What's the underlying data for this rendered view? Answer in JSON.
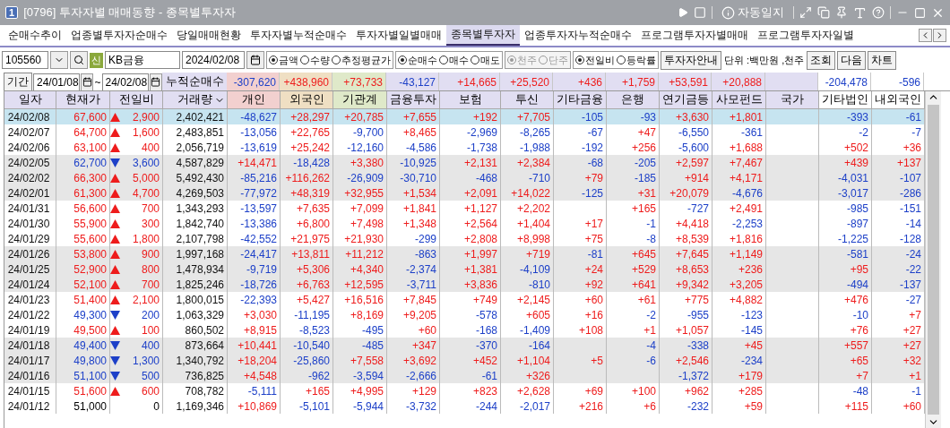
{
  "window": {
    "badge": "1",
    "title": "[0796] 투자자별 매매동향 - 종목별투자자",
    "auto_journal": "자동일지"
  },
  "tabs": [
    {
      "label": "순매수추이",
      "selected": false
    },
    {
      "label": "업종별투자자순매수",
      "selected": false
    },
    {
      "label": "당일매매현황",
      "selected": false
    },
    {
      "label": "투자자별누적순매수",
      "selected": false
    },
    {
      "label": "투자자별일별매매",
      "selected": false
    },
    {
      "label": "종목별투자자",
      "selected": true
    },
    {
      "label": "업종투자자누적순매수",
      "selected": false
    },
    {
      "label": "프로그램투자자별매매",
      "selected": false
    },
    {
      "label": "프로그램투자자일별",
      "selected": false
    }
  ],
  "controls": {
    "code": "105560",
    "credit_badge": "신",
    "name": "KB금융",
    "date": "2024/02/08",
    "radio_groups": [
      {
        "disabled": false,
        "options": [
          {
            "label": "금액",
            "selected": true
          },
          {
            "label": "수량",
            "selected": false
          },
          {
            "label": "추정평균가",
            "selected": false
          }
        ]
      },
      {
        "disabled": false,
        "options": [
          {
            "label": "순매수",
            "selected": true
          },
          {
            "label": "매수",
            "selected": false
          },
          {
            "label": "매도",
            "selected": false
          }
        ]
      },
      {
        "disabled": true,
        "options": [
          {
            "label": "천주",
            "selected": true
          },
          {
            "label": "단주",
            "selected": false
          }
        ]
      },
      {
        "disabled": false,
        "options": [
          {
            "label": "전일비",
            "selected": true
          },
          {
            "label": "등락률",
            "selected": false
          }
        ]
      }
    ],
    "guide_button": "투자자안내",
    "unit": "단위 :백만원 ,천주",
    "buttons": [
      "조회",
      "다음",
      "차트"
    ]
  },
  "period": {
    "button": "기간",
    "from": "24/01/08",
    "separator": "~",
    "to": "24/02/08",
    "label": "누적순매수",
    "totals": {
      "individual": "-307,620",
      "foreign": "+438,960",
      "institution": "+73,733",
      "fin_invest": "-43,127",
      "insurance": "+14,665",
      "trust": "+25,520",
      "other_fin": "+436",
      "bank": "+1,759",
      "pension": "+53,591",
      "private_fund": "+20,888",
      "other_corp": "-204,478",
      "domestic_foreign": "-596"
    }
  },
  "table": {
    "columns": [
      "일자",
      "현재가",
      "전일비",
      "거래량",
      "개인",
      "외국인",
      "기관계",
      "금융투자",
      "보험",
      "투신",
      "기타금융",
      "은행",
      "연기금등",
      "사모펀드",
      "국가",
      "기타법인",
      "내외국인"
    ],
    "rows": [
      {
        "date": "24/02/08",
        "price": "67,600",
        "kind": "up",
        "change": "2,900",
        "volume": "2,402,421",
        "selected": true,
        "values": {
          "individual": "-48,627",
          "foreign": "+28,297",
          "institution": "+20,785",
          "fin_invest": "+7,655",
          "insurance": "+192",
          "trust": "+7,705",
          "other_fin": "-105",
          "bank": "-93",
          "pension": "+3,630",
          "private_fund": "+1,801",
          "other_corp": "-393",
          "domestic_foreign": "-61"
        }
      },
      {
        "date": "24/02/07",
        "price": "64,700",
        "kind": "up",
        "change": "1,600",
        "volume": "2,483,851",
        "selected": false,
        "values": {
          "individual": "-13,056",
          "foreign": "+22,765",
          "institution": "-9,700",
          "fin_invest": "+8,465",
          "insurance": "-2,969",
          "trust": "-8,265",
          "other_fin": "-67",
          "bank": "+47",
          "pension": "-6,550",
          "private_fund": "-361",
          "other_corp": "-2",
          "domestic_foreign": "-7"
        }
      },
      {
        "date": "24/02/06",
        "price": "63,100",
        "kind": "up",
        "change": "400",
        "volume": "2,056,719",
        "selected": false,
        "values": {
          "individual": "-13,619",
          "foreign": "+25,242",
          "institution": "-12,160",
          "fin_invest": "-4,586",
          "insurance": "-1,738",
          "trust": "-1,988",
          "other_fin": "-192",
          "bank": "+256",
          "pension": "-5,600",
          "private_fund": "+1,688",
          "other_corp": "+502",
          "domestic_foreign": "+36"
        }
      },
      {
        "date": "24/02/05",
        "price": "62,700",
        "kind": "down",
        "change": "3,600",
        "volume": "4,587,829",
        "selected": false,
        "values": {
          "individual": "+14,471",
          "foreign": "-18,428",
          "institution": "+3,380",
          "fin_invest": "-10,925",
          "insurance": "+2,131",
          "trust": "+2,384",
          "other_fin": "-68",
          "bank": "-205",
          "pension": "+2,597",
          "private_fund": "+7,467",
          "other_corp": "+439",
          "domestic_foreign": "+137"
        }
      },
      {
        "date": "24/02/02",
        "price": "66,300",
        "kind": "up",
        "change": "5,000",
        "volume": "5,492,430",
        "selected": false,
        "values": {
          "individual": "-85,216",
          "foreign": "+116,262",
          "institution": "-26,909",
          "fin_invest": "-30,710",
          "insurance": "-468",
          "trust": "-710",
          "other_fin": "+79",
          "bank": "-185",
          "pension": "+914",
          "private_fund": "+4,171",
          "other_corp": "-4,031",
          "domestic_foreign": "-107"
        }
      },
      {
        "date": "24/02/01",
        "price": "61,300",
        "kind": "up",
        "change": "4,700",
        "volume": "4,269,503",
        "selected": false,
        "values": {
          "individual": "-77,972",
          "foreign": "+48,319",
          "institution": "+32,955",
          "fin_invest": "+1,534",
          "insurance": "+2,091",
          "trust": "+14,022",
          "other_fin": "-125",
          "bank": "+31",
          "pension": "+20,079",
          "private_fund": "-4,676",
          "other_corp": "-3,017",
          "domestic_foreign": "-286"
        }
      },
      {
        "date": "24/01/31",
        "price": "56,600",
        "kind": "up",
        "change": "700",
        "volume": "1,343,293",
        "selected": false,
        "values": {
          "individual": "-13,597",
          "foreign": "+7,635",
          "institution": "+7,099",
          "fin_invest": "+1,841",
          "insurance": "+1,127",
          "trust": "+2,202",
          "bank": "+165",
          "pension": "-727",
          "private_fund": "+2,491",
          "other_corp": "-985",
          "domestic_foreign": "-151"
        }
      },
      {
        "date": "24/01/30",
        "price": "55,900",
        "kind": "up",
        "change": "300",
        "volume": "1,842,740",
        "selected": false,
        "values": {
          "individual": "-13,386",
          "foreign": "+6,800",
          "institution": "+7,498",
          "fin_invest": "+1,348",
          "insurance": "+2,564",
          "trust": "+1,404",
          "other_fin": "+17",
          "bank": "-1",
          "pension": "+4,418",
          "private_fund": "-2,253",
          "other_corp": "-897",
          "domestic_foreign": "-14"
        }
      },
      {
        "date": "24/01/29",
        "price": "55,600",
        "kind": "up",
        "change": "1,800",
        "volume": "2,107,798",
        "selected": false,
        "values": {
          "individual": "-42,552",
          "foreign": "+21,975",
          "institution": "+21,930",
          "fin_invest": "-299",
          "insurance": "+2,808",
          "trust": "+8,998",
          "other_fin": "+75",
          "bank": "-8",
          "pension": "+8,539",
          "private_fund": "+1,816",
          "other_corp": "-1,225",
          "domestic_foreign": "-128"
        }
      },
      {
        "date": "24/01/26",
        "price": "53,800",
        "kind": "up",
        "change": "900",
        "volume": "1,997,168",
        "selected": false,
        "values": {
          "individual": "-24,417",
          "foreign": "+13,811",
          "institution": "+11,212",
          "fin_invest": "-863",
          "insurance": "+1,997",
          "trust": "+719",
          "other_fin": "-81",
          "bank": "+645",
          "pension": "+7,645",
          "private_fund": "+1,149",
          "other_corp": "-581",
          "domestic_foreign": "-24"
        }
      },
      {
        "date": "24/01/25",
        "price": "52,900",
        "kind": "up",
        "change": "800",
        "volume": "1,478,934",
        "selected": false,
        "values": {
          "individual": "-9,719",
          "foreign": "+5,306",
          "institution": "+4,340",
          "fin_invest": "-2,374",
          "insurance": "+1,381",
          "trust": "-4,109",
          "other_fin": "+24",
          "bank": "+529",
          "pension": "+8,653",
          "private_fund": "+236",
          "other_corp": "+95",
          "domestic_foreign": "-22"
        }
      },
      {
        "date": "24/01/24",
        "price": "52,100",
        "kind": "up",
        "change": "700",
        "volume": "1,825,246",
        "selected": false,
        "values": {
          "individual": "-18,726",
          "foreign": "+6,763",
          "institution": "+12,595",
          "fin_invest": "-3,711",
          "insurance": "+3,836",
          "trust": "-810",
          "other_fin": "+92",
          "bank": "+641",
          "pension": "+9,342",
          "private_fund": "+3,205",
          "other_corp": "-494",
          "domestic_foreign": "-137"
        }
      },
      {
        "date": "24/01/23",
        "price": "51,400",
        "kind": "up",
        "change": "2,100",
        "volume": "1,800,015",
        "selected": false,
        "values": {
          "individual": "-22,393",
          "foreign": "+5,427",
          "institution": "+16,516",
          "fin_invest": "+7,845",
          "insurance": "+749",
          "trust": "+2,145",
          "other_fin": "+60",
          "bank": "+61",
          "pension": "+775",
          "private_fund": "+4,882",
          "other_corp": "+476",
          "domestic_foreign": "-27"
        }
      },
      {
        "date": "24/01/22",
        "price": "49,300",
        "kind": "down",
        "change": "200",
        "volume": "1,063,329",
        "selected": false,
        "values": {
          "individual": "+3,030",
          "foreign": "-11,195",
          "institution": "+8,169",
          "fin_invest": "+9,205",
          "insurance": "-578",
          "trust": "+605",
          "other_fin": "+16",
          "bank": "-2",
          "pension": "-955",
          "private_fund": "-123",
          "other_corp": "-10",
          "domestic_foreign": "+7"
        }
      },
      {
        "date": "24/01/19",
        "price": "49,500",
        "kind": "up",
        "change": "100",
        "volume": "860,502",
        "selected": false,
        "values": {
          "individual": "+8,915",
          "foreign": "-8,523",
          "institution": "-495",
          "fin_invest": "+60",
          "insurance": "-168",
          "trust": "-1,409",
          "other_fin": "+108",
          "bank": "+1",
          "pension": "+1,057",
          "private_fund": "-145",
          "other_corp": "+76",
          "domestic_foreign": "+27"
        }
      },
      {
        "date": "24/01/18",
        "price": "49,400",
        "kind": "down",
        "change": "400",
        "volume": "873,664",
        "selected": false,
        "values": {
          "individual": "+10,441",
          "foreign": "-10,540",
          "institution": "-485",
          "fin_invest": "+347",
          "insurance": "-370",
          "trust": "-164",
          "bank": "-4",
          "pension": "-338",
          "private_fund": "+45",
          "other_corp": "+557",
          "domestic_foreign": "+27"
        }
      },
      {
        "date": "24/01/17",
        "price": "49,800",
        "kind": "down",
        "change": "1,300",
        "volume": "1,340,792",
        "selected": false,
        "values": {
          "individual": "+18,204",
          "foreign": "-25,860",
          "institution": "+7,558",
          "fin_invest": "+3,692",
          "insurance": "+452",
          "trust": "+1,104",
          "other_fin": "+5",
          "bank": "-6",
          "pension": "+2,546",
          "private_fund": "-234",
          "other_corp": "+65",
          "domestic_foreign": "+32"
        }
      },
      {
        "date": "24/01/16",
        "price": "51,100",
        "kind": "down",
        "change": "500",
        "volume": "736,825",
        "selected": false,
        "values": {
          "individual": "+4,548",
          "foreign": "-962",
          "institution": "-3,594",
          "fin_invest": "-2,666",
          "insurance": "-61",
          "trust": "+326",
          "pension": "-1,372",
          "private_fund": "+179",
          "other_corp": "+7",
          "domestic_foreign": "+1"
        }
      },
      {
        "date": "24/01/15",
        "price": "51,600",
        "kind": "up",
        "change": "600",
        "volume": "708,782",
        "selected": false,
        "values": {
          "individual": "-5,111",
          "foreign": "+165",
          "institution": "+4,995",
          "fin_invest": "+129",
          "insurance": "+823",
          "trust": "+2,628",
          "other_fin": "+69",
          "bank": "+100",
          "pension": "+962",
          "private_fund": "+285",
          "other_corp": "-48",
          "domestic_foreign": "-1"
        }
      },
      {
        "date": "24/01/12",
        "price": "51,000",
        "kind": "flat",
        "change": "0",
        "volume": "1,169,346",
        "selected": false,
        "values": {
          "individual": "+10,869",
          "foreign": "-5,101",
          "institution": "-5,944",
          "fin_invest": "-3,732",
          "insurance": "-244",
          "trust": "-2,017",
          "other_fin": "+216",
          "bank": "+6",
          "pension": "-232",
          "private_fund": "+59",
          "other_corp": "+115",
          "domestic_foreign": "+60"
        }
      }
    ]
  }
}
